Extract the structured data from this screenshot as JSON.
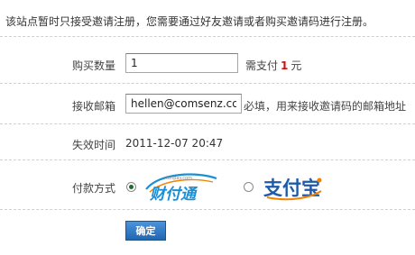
{
  "notice": "该站点暂时只接受邀请注册，您需要通过好友邀请或者购买邀请码进行注册。",
  "quantity": {
    "label": "购买数量",
    "value": "1",
    "pay_prefix": "需支付",
    "amount": "1",
    "unit": "元"
  },
  "email": {
    "label": "接收邮箱",
    "value": "hellen@comsenz.com",
    "hint": "必填，用来接收邀请码的邮箱地址"
  },
  "expiry": {
    "label": "失效时间",
    "value": "2011-12-07 20:47"
  },
  "payment": {
    "label": "付款方式",
    "selected": "tenpay",
    "tenpay": {
      "name": "财付通",
      "url_text": "tenpay.com"
    },
    "alipay": {
      "name": "支付宝"
    }
  },
  "submit_label": "确定",
  "colors": {
    "amount_red": "#cc1111",
    "button_blue": "#2b6cb5",
    "tenpay_blue": "#1a8fd6",
    "tenpay_orange": "#f08300",
    "alipay_blue": "#1e5aa8",
    "alipay_orange": "#f08300"
  }
}
